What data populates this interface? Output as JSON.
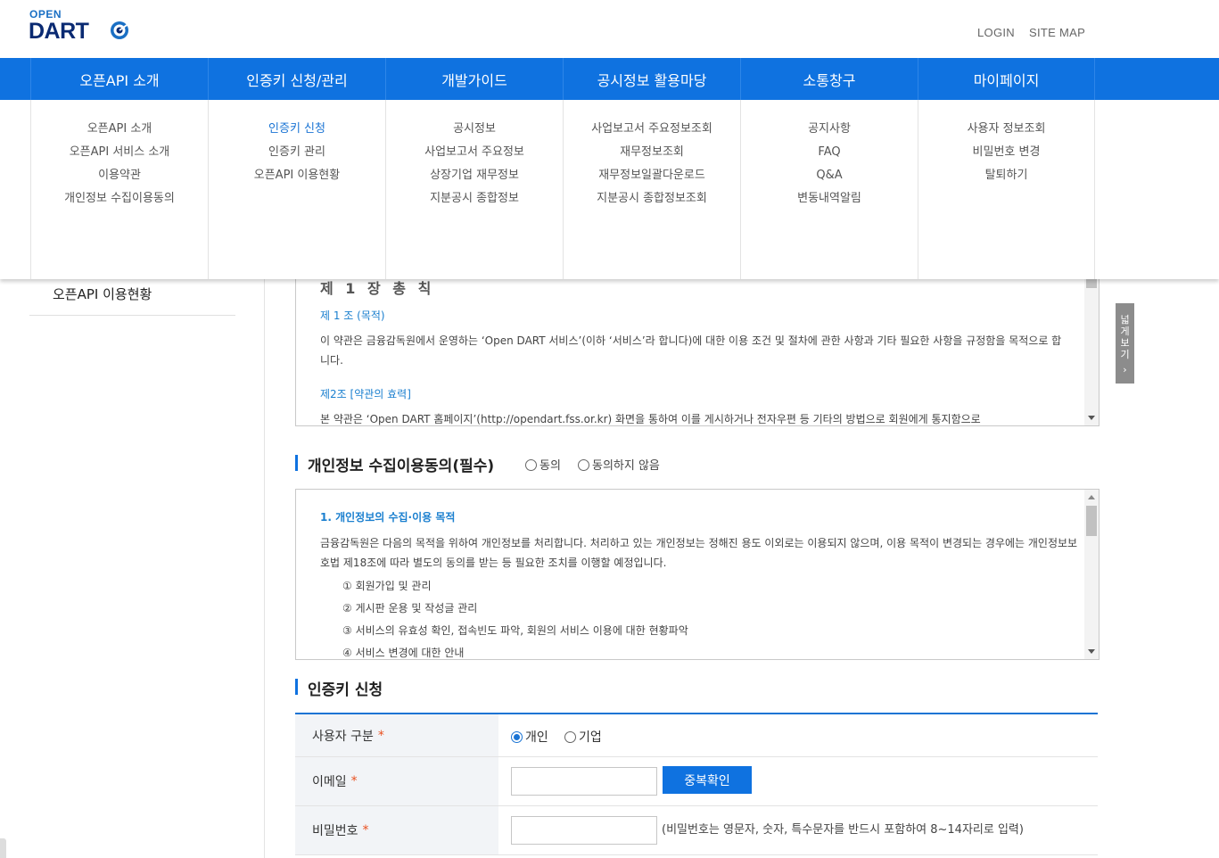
{
  "header": {
    "logo_top": "OPEN",
    "logo_main": "DART",
    "login": "LOGIN",
    "sitemap": "SITE MAP"
  },
  "gnb": [
    {
      "label": "오픈API 소개",
      "items": [
        "오픈API 소개",
        "오픈API 서비스 소개",
        "이용약관",
        "개인정보 수집이용동의"
      ]
    },
    {
      "label": "인증키 신청/관리",
      "items": [
        "인증키 신청",
        "인증키 관리",
        "오픈API 이용현황"
      ],
      "active_item": 0
    },
    {
      "label": "개발가이드",
      "items": [
        "공시정보",
        "사업보고서 주요정보",
        "상장기업 재무정보",
        "지분공시 종합정보"
      ]
    },
    {
      "label": "공시정보 활용마당",
      "items": [
        "사업보고서 주요정보조회",
        "재무정보조회",
        "재무정보일괄다운로드",
        "지분공시 종합정보조회"
      ]
    },
    {
      "label": "소통창구",
      "items": [
        "공지사항",
        "FAQ",
        "Q&A",
        "변동내역알림"
      ]
    },
    {
      "label": "마이페이지",
      "items": [
        "사용자 정보조회",
        "비밀번호 변경",
        "탈퇴하기"
      ]
    }
  ],
  "lnb": {
    "current": "오픈API 이용현황"
  },
  "side_tab": {
    "label": "넓게보기",
    "arrow": "›"
  },
  "terms": {
    "chapter": "제 1 장 총 칙",
    "art1_title": "제 1 조 (목적)",
    "art1_body": "이 약관은 금융감독원에서 운영하는 ‘Open DART 서비스’(이하 ‘서비스’라 합니다)에 대한 이용 조건 및 절차에 관한 사항과 기타 필요한 사항을 규정함을 목적으로 합니다.",
    "art2_title": "제2조 [약관의 효력]",
    "art2_body": "본 약관은 ‘Open DART 홈페이지’(http://opendart.fss.or.kr) 화면을 통하여 이를 게시하거나 전자우편 등 기타의 방법으로 회원에게 통지함으로"
  },
  "privacy": {
    "title": "개인정보 수집이용동의(필수)",
    "opt_agree": "동의",
    "opt_disagree": "동의하지 않음",
    "heading": "1. 개인정보의 수집·이용 목적",
    "body": "금융감독원은 다음의 목적을 위하여 개인정보를 처리합니다. 처리하고 있는 개인정보는 정해진 용도 이외로는 이용되지 않으며, 이용 목적이 변경되는 경우에는 개인정보보호법 제18조에 따라 별도의 동의를 받는 등 필요한 조치를 이행할 예정입니다.",
    "items": [
      "① 회원가입 및 관리",
      "② 게시판 운용 및 작성글 관리",
      "③ 서비스의 유효성 확인, 접속빈도 파악, 회원의 서비스 이용에 대한 현황파악",
      "④ 서비스 변경에 대한 안내"
    ]
  },
  "apply": {
    "title": "인증키 신청",
    "user_type_label": "사용자 구분",
    "opt_personal": "개인",
    "opt_company": "기업",
    "email_label": "이메일",
    "email_value": "",
    "dup_check": "중복확인",
    "password_label": "비밀번호",
    "password_value": "",
    "password_hint": "(비밀번호는 영문자, 숫자, 특수문자를 반드시 포함하여 8~14자리로 입력)",
    "required_mark": "*"
  }
}
